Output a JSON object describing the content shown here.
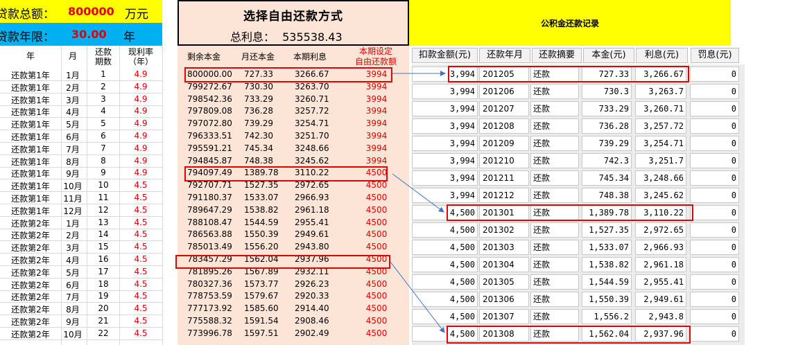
{
  "header": {
    "loan_amount_label": "贷款总额：",
    "loan_amount_value": "800000",
    "loan_amount_unit": "万元",
    "loan_term_label": "贷款年限：",
    "loan_term_value": "30.00",
    "loan_term_unit": "年",
    "mode_title": "选择自由还款方式",
    "total_interest_label": "总利息：",
    "total_interest_value": "535538.43",
    "record_title": "公积金还款记录"
  },
  "left_table": {
    "headers": {
      "year": "年",
      "month": "月",
      "period": "还款\n期数",
      "rate": "现利率\n（年）"
    },
    "rows": [
      {
        "year": "还款第1年",
        "month": "1月",
        "period": "1",
        "rate": "4.9"
      },
      {
        "year": "还款第1年",
        "month": "2月",
        "period": "2",
        "rate": "4.9"
      },
      {
        "year": "还款第1年",
        "month": "3月",
        "period": "3",
        "rate": "4.9"
      },
      {
        "year": "还款第1年",
        "month": "4月",
        "period": "4",
        "rate": "4.9"
      },
      {
        "year": "还款第1年",
        "month": "5月",
        "period": "5",
        "rate": "4.9"
      },
      {
        "year": "还款第1年",
        "month": "6月",
        "period": "6",
        "rate": "4.9"
      },
      {
        "year": "还款第1年",
        "month": "7月",
        "period": "7",
        "rate": "4.9"
      },
      {
        "year": "还款第1年",
        "month": "8月",
        "period": "8",
        "rate": "4.9"
      },
      {
        "year": "还款第1年",
        "month": "9月",
        "period": "9",
        "rate": "4.9"
      },
      {
        "year": "还款第1年",
        "month": "10月",
        "period": "10",
        "rate": "4.5"
      },
      {
        "year": "还款第1年",
        "month": "11月",
        "period": "11",
        "rate": "4.5"
      },
      {
        "year": "还款第1年",
        "month": "12月",
        "period": "12",
        "rate": "4.5"
      },
      {
        "year": "还款第2年",
        "month": "1月",
        "period": "13",
        "rate": "4.5"
      },
      {
        "year": "还款第2年",
        "month": "2月",
        "period": "14",
        "rate": "4.5"
      },
      {
        "year": "还款第2年",
        "month": "3月",
        "period": "15",
        "rate": "4.5"
      },
      {
        "year": "还款第2年",
        "month": "4月",
        "period": "16",
        "rate": "4.5"
      },
      {
        "year": "还款第2年",
        "month": "5月",
        "period": "17",
        "rate": "4.5"
      },
      {
        "year": "还款第2年",
        "month": "6月",
        "period": "18",
        "rate": "4.5"
      },
      {
        "year": "还款第2年",
        "month": "7月",
        "period": "19",
        "rate": "4.5"
      },
      {
        "year": "还款第2年",
        "month": "8月",
        "period": "20",
        "rate": "4.5"
      },
      {
        "year": "还款第2年",
        "month": "9月",
        "period": "21",
        "rate": "4.5"
      },
      {
        "year": "还款第2年",
        "month": "10月",
        "period": "22",
        "rate": "4.5"
      }
    ]
  },
  "mid_table": {
    "headers": {
      "remaining": "剩余本金",
      "monthly": "月还本金",
      "interest": "本期利息",
      "setting": "本期设定\n自由还款额"
    },
    "rows": [
      {
        "remaining": "800000.00",
        "monthly": "727.33",
        "interest": "3266.67",
        "setting": "3994"
      },
      {
        "remaining": "799272.67",
        "monthly": "730.30",
        "interest": "3263.70",
        "setting": "3994"
      },
      {
        "remaining": "798542.36",
        "monthly": "733.29",
        "interest": "3260.71",
        "setting": "3994"
      },
      {
        "remaining": "797809.08",
        "monthly": "736.28",
        "interest": "3257.72",
        "setting": "3994"
      },
      {
        "remaining": "797072.80",
        "monthly": "739.29",
        "interest": "3254.71",
        "setting": "3994"
      },
      {
        "remaining": "796333.51",
        "monthly": "742.30",
        "interest": "3251.70",
        "setting": "3994"
      },
      {
        "remaining": "795591.21",
        "monthly": "745.34",
        "interest": "3248.66",
        "setting": "3994"
      },
      {
        "remaining": "794845.87",
        "monthly": "748.38",
        "interest": "3245.62",
        "setting": "3994"
      },
      {
        "remaining": "794097.49",
        "monthly": "1389.78",
        "interest": "3110.22",
        "setting": "4500"
      },
      {
        "remaining": "792707.71",
        "monthly": "1527.35",
        "interest": "2972.65",
        "setting": "4500"
      },
      {
        "remaining": "791180.37",
        "monthly": "1533.07",
        "interest": "2966.93",
        "setting": "4500"
      },
      {
        "remaining": "789647.29",
        "monthly": "1538.82",
        "interest": "2961.18",
        "setting": "4500"
      },
      {
        "remaining": "788108.47",
        "monthly": "1544.59",
        "interest": "2955.41",
        "setting": "4500"
      },
      {
        "remaining": "786563.88",
        "monthly": "1550.39",
        "interest": "2949.61",
        "setting": "4500"
      },
      {
        "remaining": "785013.49",
        "monthly": "1556.20",
        "interest": "2943.80",
        "setting": "4500"
      },
      {
        "remaining": "783457.29",
        "monthly": "1562.04",
        "interest": "2937.96",
        "setting": "4500"
      },
      {
        "remaining": "781895.26",
        "monthly": "1567.89",
        "interest": "2932.11",
        "setting": "4500"
      },
      {
        "remaining": "780327.36",
        "monthly": "1573.77",
        "interest": "2926.23",
        "setting": "4500"
      },
      {
        "remaining": "778753.59",
        "monthly": "1579.67",
        "interest": "2920.33",
        "setting": "4500"
      },
      {
        "remaining": "777173.92",
        "monthly": "1585.60",
        "interest": "2914.40",
        "setting": "4500"
      },
      {
        "remaining": "775588.32",
        "monthly": "1591.54",
        "interest": "2908.46",
        "setting": "4500"
      },
      {
        "remaining": "773996.78",
        "monthly": "1597.51",
        "interest": "2902.49",
        "setting": "4500"
      }
    ]
  },
  "record_table": {
    "headers": {
      "amount": "扣款金额(元)",
      "ym": "还款年月",
      "summary": "还款摘要",
      "principal": "本金(元)",
      "interest": "利息(元)",
      "penalty": "罚息(元)"
    },
    "rows": [
      {
        "amount": "3,994",
        "ym": "201205",
        "summary": "还款",
        "principal": "727.33",
        "interest": "3,266.67",
        "penalty": "0"
      },
      {
        "amount": "3,994",
        "ym": "201206",
        "summary": "还款",
        "principal": "730.3",
        "interest": "3,263.7",
        "penalty": "0"
      },
      {
        "amount": "3,994",
        "ym": "201207",
        "summary": "还款",
        "principal": "733.29",
        "interest": "3,260.71",
        "penalty": "0"
      },
      {
        "amount": "3,994",
        "ym": "201208",
        "summary": "还款",
        "principal": "736.28",
        "interest": "3,257.72",
        "penalty": "0"
      },
      {
        "amount": "3,994",
        "ym": "201209",
        "summary": "还款",
        "principal": "739.29",
        "interest": "3,254.71",
        "penalty": "0"
      },
      {
        "amount": "3,994",
        "ym": "201210",
        "summary": "还款",
        "principal": "742.3",
        "interest": "3,251.7",
        "penalty": "0"
      },
      {
        "amount": "3,994",
        "ym": "201211",
        "summary": "还款",
        "principal": "745.34",
        "interest": "3,248.66",
        "penalty": "0"
      },
      {
        "amount": "3,994",
        "ym": "201212",
        "summary": "还款",
        "principal": "748.38",
        "interest": "3,245.62",
        "penalty": "0"
      },
      {
        "amount": "4,500",
        "ym": "201301",
        "summary": "还款",
        "principal": "1,389.78",
        "interest": "3,110.22",
        "penalty": "0"
      },
      {
        "amount": "4,500",
        "ym": "201302",
        "summary": "还款",
        "principal": "1,527.35",
        "interest": "2,972.65",
        "penalty": "0"
      },
      {
        "amount": "4,500",
        "ym": "201303",
        "summary": "还款",
        "principal": "1,533.07",
        "interest": "2,966.93",
        "penalty": "0"
      },
      {
        "amount": "4,500",
        "ym": "201304",
        "summary": "还款",
        "principal": "1,538.82",
        "interest": "2,961.18",
        "penalty": "0"
      },
      {
        "amount": "4,500",
        "ym": "201305",
        "summary": "还款",
        "principal": "1,544.59",
        "interest": "2,955.41",
        "penalty": "0"
      },
      {
        "amount": "4,500",
        "ym": "201306",
        "summary": "还款",
        "principal": "1,550.39",
        "interest": "2,949.61",
        "penalty": "0"
      },
      {
        "amount": "4,500",
        "ym": "201307",
        "summary": "还款",
        "principal": "1,556.2",
        "interest": "2,943.8",
        "penalty": "0"
      },
      {
        "amount": "4,500",
        "ym": "201308",
        "summary": "还款",
        "principal": "1,562.04",
        "interest": "2,937.96",
        "penalty": "0"
      }
    ]
  },
  "colors": {
    "accent_red": "#e00000",
    "header_yellow": "#ffff00",
    "header_blue": "#00b0f0",
    "peach": "#fce4d6"
  }
}
